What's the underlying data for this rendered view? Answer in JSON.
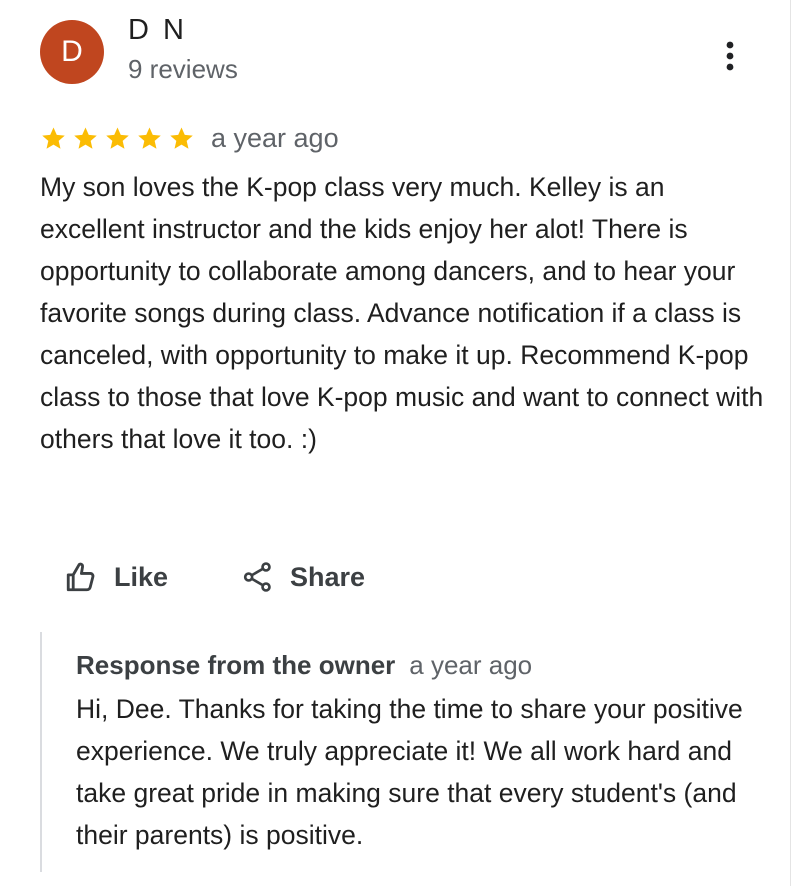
{
  "reviewer": {
    "avatar_initial": "D",
    "name": "D N",
    "review_count": "9 reviews",
    "avatar_color": "#c0461f"
  },
  "menu": {
    "icon": "more-vertical-icon"
  },
  "review": {
    "rating": 5,
    "max_rating": 5,
    "star_color": "#fbbc04",
    "date": "a year ago",
    "text": "My son loves the K-pop class very much. Kelley is an excellent instructor and the kids enjoy her alot! There is opportunity to collaborate among dancers, and to hear your favorite songs during class. Advance notification if a class is canceled, with opportunity to make it up. Recommend K-pop class to those that love K-pop music and want to connect with others that love it too. :)"
  },
  "actions": {
    "like_label": "Like",
    "like_icon": "thumbs-up-icon",
    "share_label": "Share",
    "share_icon": "share-icon"
  },
  "owner_response": {
    "title": "Response from the owner",
    "date": "a year ago",
    "text": "Hi, Dee. Thanks for taking the time to share your positive experience. We truly appreciate it! We all work hard and take great pride in making sure that every student's (and their parents) is positive."
  }
}
